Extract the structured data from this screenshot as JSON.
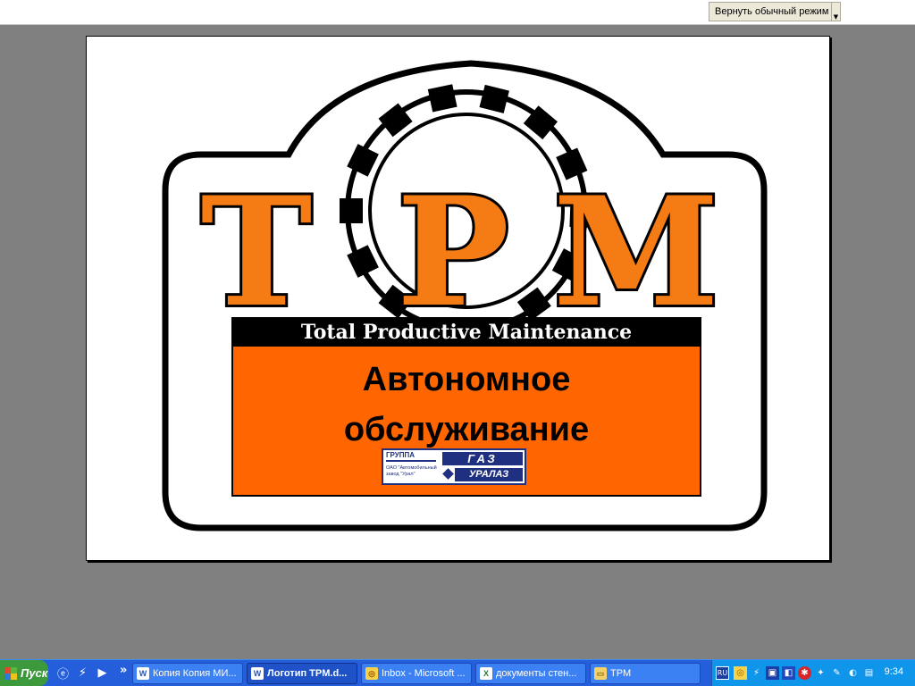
{
  "toolbar": {
    "restore_view_label": "Вернуть обычный режим"
  },
  "logo": {
    "letters": [
      "T",
      "P",
      "M"
    ],
    "subtitle": "Total Productive Maintenance",
    "title_line1": "Автономное",
    "title_line2": "обслуживание",
    "badge": {
      "group_label": "ГРУППА",
      "org_text": "ОАО \"Автомобильный завод \"Урал\"",
      "gaz_mark": "ГАЗ",
      "ural_mark": "УРАЛАЗ"
    }
  },
  "colors": {
    "accent_orange": "#f57c14",
    "box_orange": "#ff6600",
    "workspace_gray": "#808080",
    "badge_blue": "#203080"
  },
  "taskbar": {
    "start_label": "Пуск",
    "quick_launch": [
      "ie-icon",
      "winamp-icon",
      "media-player-icon"
    ],
    "more_label": "»",
    "tasks": [
      {
        "label": "Копия Копия МИ...",
        "icon": "word-icon",
        "active": false
      },
      {
        "label": "Логотип TPM.d...",
        "icon": "word-icon",
        "active": true
      },
      {
        "label": "Inbox - Microsoft ...",
        "icon": "outlook-icon",
        "active": false
      },
      {
        "label": "документы стен...",
        "icon": "excel-icon",
        "active": false
      },
      {
        "label": "TPM",
        "icon": "folder-icon",
        "active": false
      }
    ],
    "tray": {
      "language": "RU",
      "clock": "9:34"
    }
  }
}
